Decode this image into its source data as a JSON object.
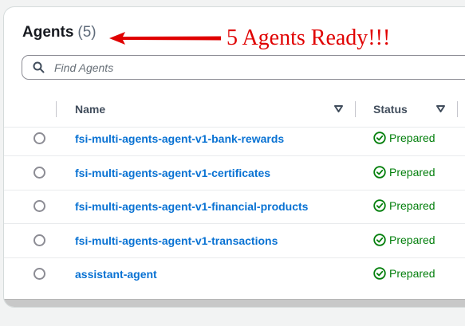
{
  "header": {
    "title": "Agents",
    "count": "(5)"
  },
  "annotation": {
    "text": "5 Agents Ready!!!",
    "color": "#e00000"
  },
  "search": {
    "placeholder": "Find Agents",
    "value": ""
  },
  "table": {
    "columns": [
      {
        "label": "Name"
      },
      {
        "label": "Status"
      }
    ],
    "rows": [
      {
        "name": "fsi-multi-agents-agent-v1-bank-rewards",
        "status": "Prepared"
      },
      {
        "name": "fsi-multi-agents-agent-v1-certificates",
        "status": "Prepared"
      },
      {
        "name": "fsi-multi-agents-agent-v1-financial-products",
        "status": "Prepared"
      },
      {
        "name": "fsi-multi-agents-agent-v1-transactions",
        "status": "Prepared"
      },
      {
        "name": "assistant-agent",
        "status": "Prepared"
      }
    ]
  },
  "icons": {
    "search": "search-icon",
    "sort": "caret-down-icon",
    "status": "check-circle-icon",
    "arrow": "arrow-left-icon"
  },
  "colors": {
    "link": "#0972d3",
    "success": "#037f0c",
    "heading": "#16191f"
  }
}
